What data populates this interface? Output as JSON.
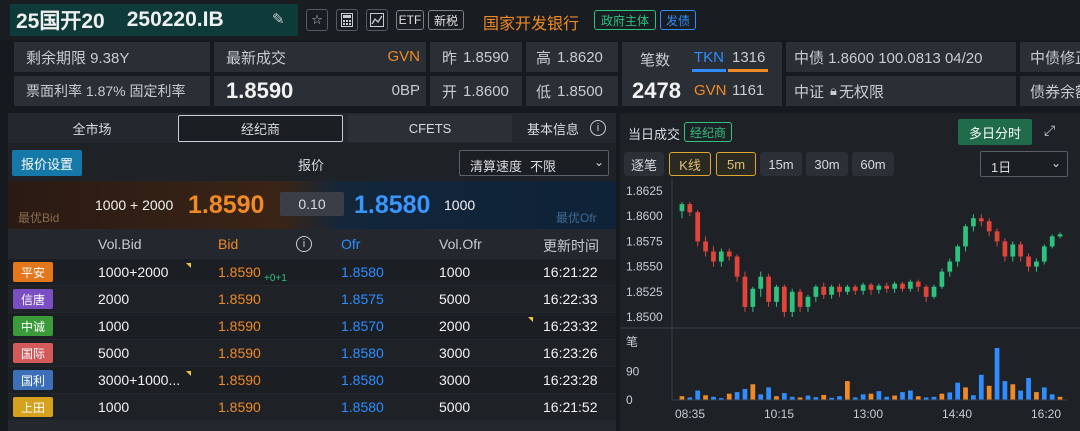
{
  "header": {
    "bond_name": "25国开20",
    "bond_code": "250220.IB",
    "tags": [
      "ETF",
      "新税"
    ],
    "issuer": "国家开发银行",
    "badge_gov": "政府主体",
    "badge_issue": "发债"
  },
  "info": {
    "remaining_term": "剩余期限 9.38Y",
    "coupon": "票面利率 1.87% 固定利率",
    "latest_trade_label": "最新成交",
    "latest_price": "1.8590",
    "gvn": "GVN",
    "obp": "0BP",
    "prev_label": "昨",
    "prev_value": "1.8590",
    "open_label": "开",
    "open_value": "1.8600",
    "high_label": "高",
    "high_value": "1.8620",
    "low_label": "低",
    "low_value": "1.8500",
    "trades_label": "笔数",
    "trades_count": "2478",
    "tkn_label": "TKN",
    "tkn_value": "1316",
    "gvn_label": "GVN",
    "gvn_value": "1161",
    "cbond_quote": "中债 1.8600 100.0813 04/20",
    "csi_label": "中证",
    "csi_value": "无权限",
    "cbond_fix": "中债修正",
    "bond_balance": "债券余额"
  },
  "tabs": {
    "all_market": "全市场",
    "broker": "经纪商",
    "cfets": "CFETS",
    "basic_info": "基本信息"
  },
  "quote_panel": {
    "settings_btn": "报价设置",
    "quote_label": "报价",
    "clear_speed_label": "清算速度",
    "clear_speed_value": "不限",
    "best_bid_label": "最优Bid",
    "best_ofr_label": "最优Ofr",
    "best_bid_vol": "1000 + 2000",
    "best_bid": "1.8590",
    "spread": "0.10",
    "best_ofr": "1.8580",
    "best_ofr_vol": "1000"
  },
  "columns": [
    "Vol.Bid",
    "Bid",
    "Ofr",
    "Vol.Ofr",
    "更新时间"
  ],
  "rows": [
    {
      "broker": "平安",
      "color": "#e4761b",
      "vol_bid": "1000+2000",
      "bid": "1.8590",
      "bid_extra": "+0+1",
      "ofr": "1.8580",
      "vol_ofr": "1000",
      "time": "16:21:22",
      "mark_bid": true,
      "mark_ofr": false
    },
    {
      "broker": "信唐",
      "color": "#7b4fc2",
      "vol_bid": "2000",
      "bid": "1.8590",
      "bid_extra": "",
      "ofr": "1.8575",
      "vol_ofr": "5000",
      "time": "16:22:33",
      "mark_bid": false,
      "mark_ofr": false
    },
    {
      "broker": "中诚",
      "color": "#3b9b3b",
      "vol_bid": "1000",
      "bid": "1.8590",
      "bid_extra": "",
      "ofr": "1.8570",
      "vol_ofr": "2000",
      "time": "16:23:32",
      "mark_bid": false,
      "mark_ofr": true
    },
    {
      "broker": "国际",
      "color": "#d45a5a",
      "vol_bid": "5000",
      "bid": "1.8590",
      "bid_extra": "",
      "ofr": "1.8580",
      "vol_ofr": "3000",
      "time": "16:23:26",
      "mark_bid": false,
      "mark_ofr": false
    },
    {
      "broker": "国利",
      "color": "#3d6fb8",
      "vol_bid": "3000+1000...",
      "bid": "1.8590",
      "bid_extra": "",
      "ofr": "1.8580",
      "vol_ofr": "3000",
      "time": "16:23:28",
      "mark_bid": true,
      "mark_ofr": false
    },
    {
      "broker": "上田",
      "color": "#d6a21e",
      "vol_bid": "1000",
      "bid": "1.8590",
      "bid_extra": "",
      "ofr": "1.8580",
      "vol_ofr": "5000",
      "time": "16:21:52",
      "mark_bid": false,
      "mark_ofr": false
    }
  ],
  "chart_panel": {
    "title": "当日成交",
    "title_tag": "经纪商",
    "multi_day_btn": "多日分时",
    "tick_btn": "逐笔",
    "kline_btn": "K线",
    "timeframes": [
      "5m",
      "15m",
      "30m",
      "60m"
    ],
    "period_value": "1日"
  },
  "chart_data": {
    "type": "candlestick",
    "y_ticks": [
      "1.8625",
      "1.8600",
      "1.8575",
      "1.8550",
      "1.8525",
      "1.8500"
    ],
    "ylim": [
      1.8495,
      1.863
    ],
    "x_ticks": [
      "08:35",
      "10:15",
      "13:00",
      "14:40",
      "16:20"
    ],
    "volume_label": "笔",
    "volume_ticks": [
      "90",
      "0"
    ],
    "volume_max": 165,
    "up_color": "#2ec27e",
    "down_color": "#e0443b",
    "candles": [
      [
        1.8605,
        1.8612,
        1.8598,
        1.8614
      ],
      [
        1.8612,
        1.8604,
        1.86,
        1.8614
      ],
      [
        1.8604,
        1.8575,
        1.857,
        1.8606
      ],
      [
        1.8575,
        1.8565,
        1.856,
        1.858
      ],
      [
        1.8565,
        1.8555,
        1.855,
        1.857
      ],
      [
        1.8555,
        1.8565,
        1.855,
        1.8568
      ],
      [
        1.8565,
        1.856,
        1.8556,
        1.8568
      ],
      [
        1.856,
        1.854,
        1.8535,
        1.8562
      ],
      [
        1.854,
        1.851,
        1.8505,
        1.8545
      ],
      [
        1.851,
        1.8528,
        1.8505,
        1.853
      ],
      [
        1.8528,
        1.854,
        1.852,
        1.8545
      ],
      [
        1.854,
        1.8515,
        1.851,
        1.8543
      ],
      [
        1.8515,
        1.853,
        1.851,
        1.8532
      ],
      [
        1.853,
        1.8505,
        1.85,
        1.8532
      ],
      [
        1.8505,
        1.8525,
        1.85,
        1.8528
      ],
      [
        1.8525,
        1.851,
        1.8505,
        1.8528
      ],
      [
        1.851,
        1.852,
        1.8505,
        1.8522
      ],
      [
        1.852,
        1.853,
        1.8515,
        1.8532
      ],
      [
        1.853,
        1.8522,
        1.8518,
        1.8534
      ],
      [
        1.8522,
        1.853,
        1.8518,
        1.8532
      ],
      [
        1.853,
        1.8525,
        1.852,
        1.8533
      ],
      [
        1.8525,
        1.853,
        1.8522,
        1.8532
      ],
      [
        1.853,
        1.8526,
        1.8522,
        1.8532
      ],
      [
        1.8526,
        1.8532,
        1.8522,
        1.8534
      ],
      [
        1.8532,
        1.8527,
        1.8522,
        1.8534
      ],
      [
        1.8527,
        1.8531,
        1.8523,
        1.8533
      ],
      [
        1.8531,
        1.8528,
        1.8524,
        1.8534
      ],
      [
        1.8528,
        1.8533,
        1.8524,
        1.8535
      ],
      [
        1.8533,
        1.8528,
        1.8525,
        1.8535
      ],
      [
        1.8528,
        1.8535,
        1.8525,
        1.8537
      ],
      [
        1.8535,
        1.853,
        1.8525,
        1.8537
      ],
      [
        1.853,
        1.852,
        1.8515,
        1.8532
      ],
      [
        1.852,
        1.853,
        1.8518,
        1.8532
      ],
      [
        1.853,
        1.8545,
        1.8528,
        1.8548
      ],
      [
        1.8545,
        1.8555,
        1.854,
        1.8558
      ],
      [
        1.8555,
        1.857,
        1.855,
        1.8572
      ],
      [
        1.857,
        1.859,
        1.8565,
        1.8592
      ],
      [
        1.859,
        1.8598,
        1.8585,
        1.8602
      ],
      [
        1.8598,
        1.8595,
        1.859,
        1.8602
      ],
      [
        1.8595,
        1.8585,
        1.858,
        1.8598
      ],
      [
        1.8585,
        1.8575,
        1.857,
        1.8588
      ],
      [
        1.8575,
        1.856,
        1.8555,
        1.8578
      ],
      [
        1.856,
        1.8572,
        1.8555,
        1.8575
      ],
      [
        1.8572,
        1.856,
        1.8555,
        1.8575
      ],
      [
        1.856,
        1.855,
        1.8545,
        1.8563
      ],
      [
        1.855,
        1.8555,
        1.8545,
        1.8558
      ],
      [
        1.8555,
        1.857,
        1.8552,
        1.8572
      ],
      [
        1.857,
        1.858,
        1.8568,
        1.8582
      ],
      [
        1.858,
        1.8582,
        1.8578,
        1.8584
      ]
    ],
    "volumes": [
      12,
      8,
      30,
      15,
      10,
      6,
      20,
      25,
      35,
      50,
      18,
      40,
      12,
      22,
      10,
      8,
      14,
      9,
      16,
      7,
      12,
      60,
      8,
      18,
      20,
      28,
      10,
      14,
      25,
      30,
      12,
      8,
      10,
      20,
      24,
      55,
      40,
      15,
      80,
      45,
      165,
      60,
      50,
      30,
      70,
      25,
      40,
      18,
      10
    ]
  }
}
